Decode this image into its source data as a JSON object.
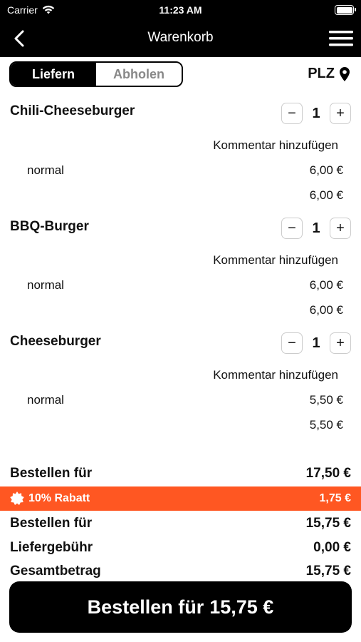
{
  "status_bar": {
    "carrier": "Carrier",
    "time": "11:23 AM"
  },
  "navbar": {
    "title": "Warenkorb"
  },
  "segmented": {
    "deliver": "Liefern",
    "pickup": "Abholen"
  },
  "plz": {
    "label": "PLZ"
  },
  "items": [
    {
      "name": "Chili-Cheeseburger",
      "quantity": "1",
      "comment": "Kommentar hinzufügen",
      "variant": "normal",
      "variant_price": "6,00 €",
      "total": "6,00 €"
    },
    {
      "name": "BBQ-Burger",
      "quantity": "1",
      "comment": "Kommentar hinzufügen",
      "variant": "normal",
      "variant_price": "6,00 €",
      "total": "6,00 €"
    },
    {
      "name": "Cheeseburger",
      "quantity": "1",
      "comment": "Kommentar hinzufügen",
      "variant": "normal",
      "variant_price": "5,50 €",
      "total": "5,50 €"
    }
  ],
  "summary": {
    "subtotal_label": "Bestellen für",
    "subtotal_value": "17,50 €",
    "discount_label": "10% Rabatt",
    "discount_value": "1,75 €",
    "after_discount_label": "Bestellen für",
    "after_discount_value": "15,75 €",
    "delivery_label": "Liefergebühr",
    "delivery_value": "0,00 €",
    "total_label": "Gesamtbetrag",
    "total_value": "15,75 €"
  },
  "order_button": {
    "label": "Bestellen für",
    "amount": "15,75 €"
  },
  "colors": {
    "accent": "#ff5722",
    "bar": "#000000"
  }
}
